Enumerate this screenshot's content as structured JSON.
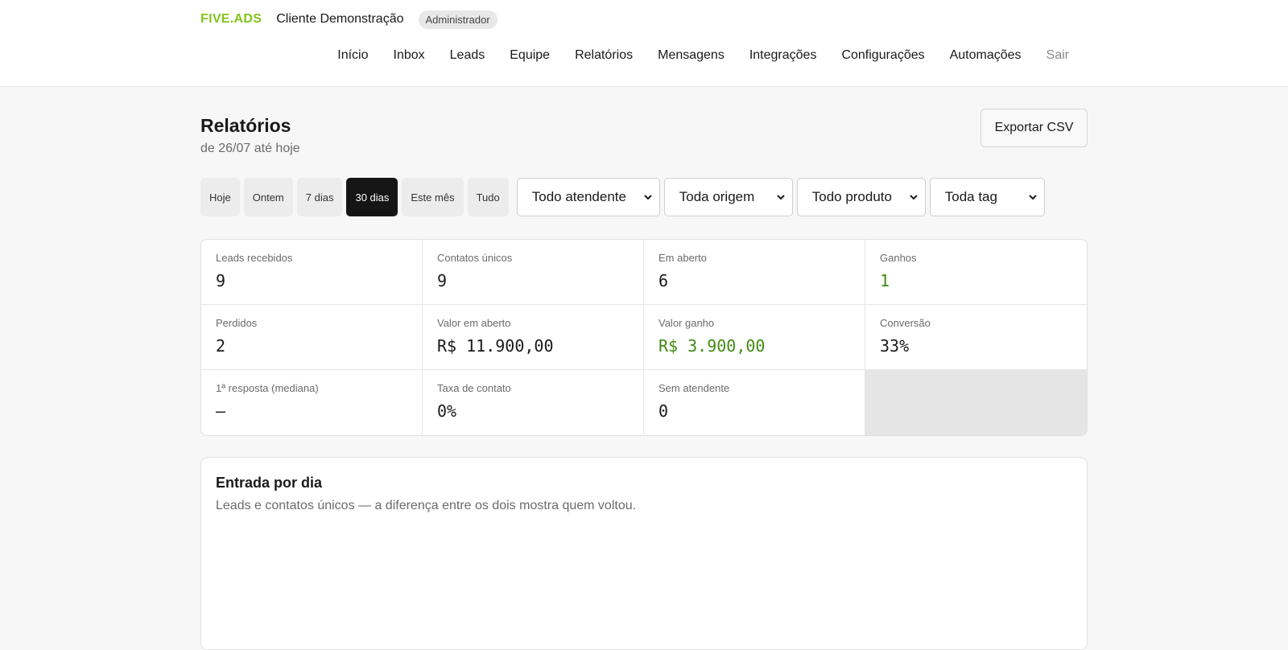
{
  "header": {
    "logo": "FIVE.ADS",
    "client": "Cliente Demonstração",
    "role": "Administrador",
    "nav": [
      {
        "label": "Início"
      },
      {
        "label": "Inbox"
      },
      {
        "label": "Leads"
      },
      {
        "label": "Equipe"
      },
      {
        "label": "Relatórios"
      },
      {
        "label": "Mensagens"
      },
      {
        "label": "Integrações"
      },
      {
        "label": "Configurações"
      },
      {
        "label": "Automações"
      },
      {
        "label": "Sair"
      }
    ]
  },
  "page": {
    "title": "Relatórios",
    "subtitle": "de 26/07 até hoje",
    "export_label": "Exportar CSV"
  },
  "filters": {
    "periods": [
      {
        "label": "Hoje"
      },
      {
        "label": "Ontem"
      },
      {
        "label": "7 dias"
      },
      {
        "label": "30 dias",
        "active": true
      },
      {
        "label": "Este mês"
      },
      {
        "label": "Tudo"
      }
    ],
    "selects": [
      {
        "value": "Todo atendente"
      },
      {
        "value": "Toda origem"
      },
      {
        "value": "Todo produto"
      },
      {
        "value": "Toda tag"
      }
    ]
  },
  "stats": [
    {
      "label": "Leads recebidos",
      "value": "9"
    },
    {
      "label": "Contatos únicos",
      "value": "9"
    },
    {
      "label": "Em aberto",
      "value": "6"
    },
    {
      "label": "Ganhos",
      "value": "1",
      "color": "#3f8b12"
    },
    {
      "label": "Perdidos",
      "value": "2"
    },
    {
      "label": "Valor em aberto",
      "value": "R$ 11.900,00"
    },
    {
      "label": "Valor ganho",
      "value": "R$ 3.900,00",
      "color": "#3f8b12"
    },
    {
      "label": "Conversão",
      "value": "33%"
    },
    {
      "label": "1ª resposta (mediana)",
      "value": "—"
    },
    {
      "label": "Taxa de contato",
      "value": "0%"
    },
    {
      "label": "Sem atendente",
      "value": "0"
    }
  ],
  "chart_card": {
    "title": "Entrada por dia",
    "description": "Leads e contatos únicos — a diferença entre os dois mostra quem voltou."
  },
  "colors": {
    "brand": "#84c41a",
    "positive": "#3f8b12",
    "active_chip": "#151515"
  }
}
